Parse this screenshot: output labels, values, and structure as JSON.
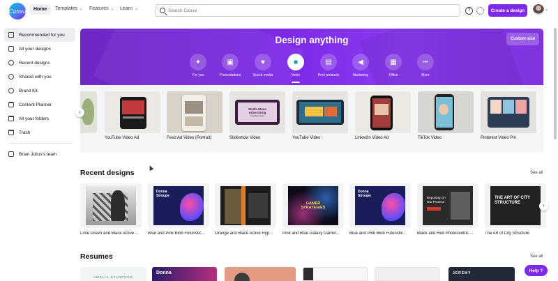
{
  "header": {
    "logo_text": "Canva",
    "nav": [
      {
        "label": "Home"
      },
      {
        "label": "Templates"
      },
      {
        "label": "Features"
      },
      {
        "label": "Learn"
      }
    ],
    "search_placeholder": "Search Canva",
    "help_glyph": "?",
    "create_label": "Create a design"
  },
  "sidebar": {
    "items": [
      {
        "label": "Recommended for you"
      },
      {
        "label": "All your designs"
      },
      {
        "label": "Recent designs"
      },
      {
        "label": "Shared with you"
      },
      {
        "label": "Brand Kit"
      },
      {
        "label": "Content Planner"
      },
      {
        "label": "All your folders"
      },
      {
        "label": "Trash"
      }
    ],
    "team": "Brian Julius's team"
  },
  "hero": {
    "title": "Design anything",
    "custom_size": "Custom size",
    "categories": [
      {
        "label": "For you",
        "icon": "sparkle-icon",
        "glyph": "✦"
      },
      {
        "label": "Presentations",
        "icon": "presentation-icon",
        "glyph": "▣"
      },
      {
        "label": "Social media",
        "icon": "heart-icon",
        "glyph": "♥"
      },
      {
        "label": "Video",
        "icon": "video-icon",
        "glyph": "■"
      },
      {
        "label": "Print products",
        "icon": "print-icon",
        "glyph": "▤"
      },
      {
        "label": "Marketing",
        "icon": "megaphone-icon",
        "glyph": "◀"
      },
      {
        "label": "Office",
        "icon": "briefcase-icon",
        "glyph": "▦"
      },
      {
        "label": "More",
        "icon": "more-icon",
        "glyph": "•••"
      }
    ],
    "active_category": "Video"
  },
  "templates": [
    {
      "label": "YouTube Video Ad"
    },
    {
      "label": "Feed Ad Video (Portrait)"
    },
    {
      "label": "Slideshow Video"
    },
    {
      "label": "YouTube Video"
    },
    {
      "label": "LinkedIn Video Ad"
    },
    {
      "label": "TikTok Video"
    },
    {
      "label": "Pinterest Video Pin"
    }
  ],
  "template_thumb_text": {
    "slideshow": "Media Muse Advertising",
    "slideshow_sub": "Inspiring Ideas"
  },
  "recent": {
    "title": "Recent designs",
    "see_all": "See all",
    "items": [
      {
        "label": "Lime Green and Black Active ..."
      },
      {
        "label": "Blue and Pink Blob Futuristic..."
      },
      {
        "label": "Orange and Black Active Hyp..."
      },
      {
        "label": "Pink and Blue Galaxy Gamin..."
      },
      {
        "label": "Blue and Pink Blob Futuristic..."
      },
      {
        "label": "Black and Red Photocentric ..."
      },
      {
        "label": "The Art of City Structure"
      }
    ],
    "thumb_text": {
      "blob1": "Donna Stroupe",
      "blob2": "Donna Stroupe",
      "gamer": "GAMER STRATEGIES",
      "reporting": "Reporting On Our Process",
      "art": "THE ART OF CITY STRUCTURE"
    }
  },
  "resumes": {
    "title": "Resumes",
    "see_all": "See all",
    "thumb_text": {
      "amelia": "AMELIA STANFORD",
      "donna": "Donna",
      "jeremy": "JEREMY"
    }
  },
  "help": {
    "label": "Help ?"
  },
  "colors": {
    "brand_purple": "#7d2ae8",
    "teal": "#00c4cc"
  }
}
